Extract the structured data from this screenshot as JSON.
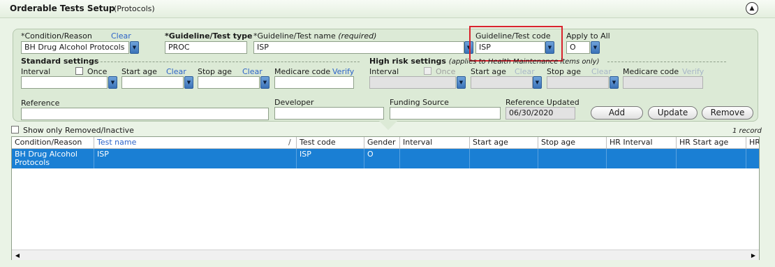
{
  "header": {
    "title": "Orderable Tests Setup",
    "subtitle": "(Protocols)",
    "collapse_glyph": "▲"
  },
  "form": {
    "condition": {
      "label": "*Condition/Reason",
      "clear": "Clear",
      "value": "BH Drug Alcohol Protocols"
    },
    "test_type": {
      "label": "*Guideline/Test type",
      "value": "PROC"
    },
    "test_name": {
      "label": "*Guideline/Test name",
      "hint": "(required)",
      "value": "ISP"
    },
    "test_code": {
      "label": "Guideline/Test code",
      "value": "ISP"
    },
    "apply_all": {
      "label": "Apply to All",
      "value": "O"
    },
    "standard": {
      "title": "Standard settings",
      "interval": "Interval",
      "once": "Once",
      "start_age": "Start age",
      "start_clear": "Clear",
      "stop_age": "Stop age",
      "stop_clear": "Clear",
      "medicare": "Medicare code",
      "verify": "Verify"
    },
    "high_risk": {
      "title": "High risk settings",
      "note": "(applies to Health Maintenance items only)",
      "interval": "Interval",
      "once": "Once",
      "start_age": "Start age",
      "start_clear": "Clear",
      "stop_age": "Stop age",
      "stop_clear": "Clear",
      "medicare": "Medicare code",
      "verify": "Verify"
    },
    "reference": {
      "label": "Reference",
      "value": ""
    },
    "developer": {
      "label": "Developer",
      "value": ""
    },
    "funding": {
      "label": "Funding Source",
      "value": ""
    },
    "ref_updated": {
      "label": "Reference Updated",
      "value": "06/30/2020"
    },
    "buttons": {
      "add": "Add",
      "update": "Update",
      "remove": "Remove"
    }
  },
  "filter": {
    "show_removed": "Show only Removed/Inactive",
    "record_count": "1 record"
  },
  "grid": {
    "columns": [
      "Condition/Reason",
      "Test name",
      "Test code",
      "Gender",
      "Interval",
      "Start age",
      "Stop age",
      "HR Interval",
      "HR Start age",
      "HR"
    ],
    "sort_glyph": "/",
    "rows": [
      {
        "condition": "BH Drug Alcohol Protocols",
        "test_name": "ISP",
        "test_code": "ISP",
        "gender": "O"
      }
    ]
  },
  "colors": {
    "accent": "#1a7fd4",
    "highlight": "#d9232d",
    "background": "#eaf3e6",
    "link": "#2c63c8"
  },
  "icons": {
    "dropdown": "chevron-down-icon",
    "collapse": "chevron-up-circle-icon",
    "scroll_left": "arrow-left-icon",
    "scroll_right": "arrow-right-icon"
  }
}
